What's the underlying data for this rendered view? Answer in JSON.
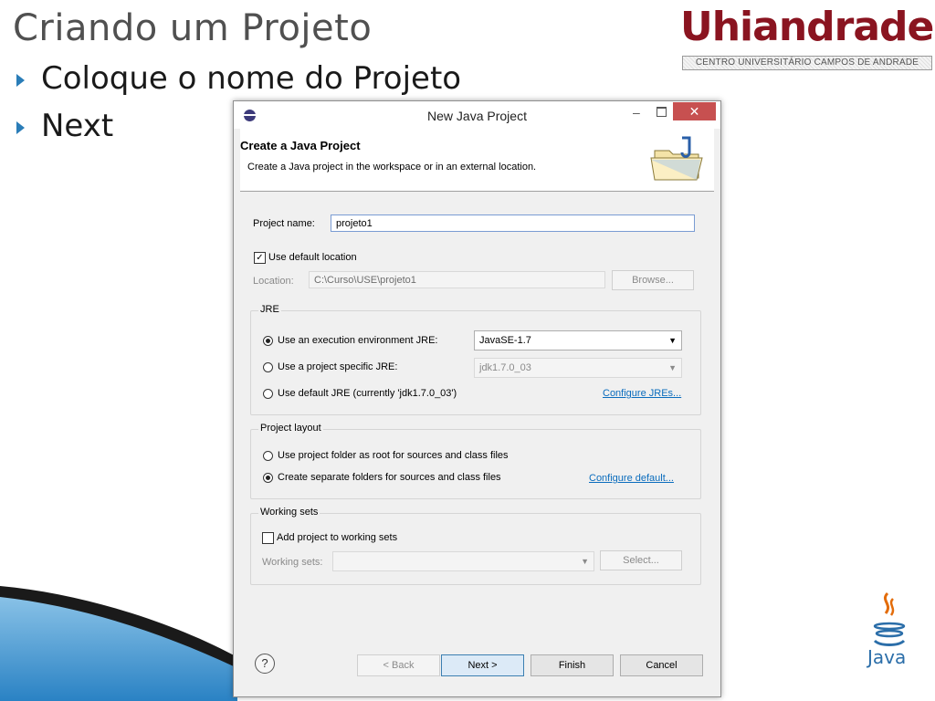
{
  "slide": {
    "title": "Criando um Projeto",
    "bullets": [
      "Coloque o nome do Projeto",
      "Next"
    ],
    "logo_text": "Uhiandrade",
    "logo_subtitle": "CENTRO UNIVERSITÁRIO CAMPOS DE ANDRADE",
    "java_logo_text": "Java"
  },
  "dialog": {
    "window_title": "New Java Project",
    "header_title": "Create a Java Project",
    "header_description": "Create a Java project in the workspace or in an external location.",
    "project_name_label": "Project name:",
    "project_name_value": "projeto1",
    "use_default_location_label": "Use default location",
    "use_default_location_checked": true,
    "location_label": "Location:",
    "location_value": "C:\\Curso\\USE\\projeto1",
    "browse_label": "Browse...",
    "jre": {
      "title": "JRE",
      "option1_label": "Use an execution environment JRE:",
      "option1_value": "JavaSE-1.7",
      "option2_label": "Use a project specific JRE:",
      "option2_value": "jdk1.7.0_03",
      "option3_label": "Use default JRE (currently 'jdk1.7.0_03')",
      "configure_link": "Configure JREs...",
      "selected": "option1"
    },
    "project_layout": {
      "title": "Project layout",
      "option1_label": "Use project folder as root for sources and class files",
      "option2_label": "Create separate folders for sources and class files",
      "configure_link": "Configure default...",
      "selected": "option2"
    },
    "working_sets": {
      "title": "Working sets",
      "add_label": "Add project to working sets",
      "add_checked": false,
      "sets_label": "Working sets:",
      "select_label": "Select..."
    },
    "buttons": {
      "help": "?",
      "back": "< Back",
      "next": "Next >",
      "finish": "Finish",
      "cancel": "Cancel"
    }
  },
  "colors": {
    "title_gray": "#505050",
    "bullet_arrow": "#2a7db8",
    "close_red": "#c75050",
    "logo_red": "#8a1420",
    "link_blue": "#0a6cbd"
  }
}
